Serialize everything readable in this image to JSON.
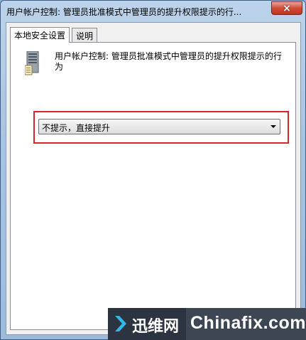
{
  "window": {
    "title": "用户帐户控制: 管理员批准模式中管理员的提升权限提示的行...",
    "close_label": "×"
  },
  "tabs": [
    {
      "label": "本地安全设置",
      "active": true
    },
    {
      "label": "说明",
      "active": false
    }
  ],
  "policy": {
    "icon": "server-icon",
    "description": "用户帐户控制: 管理员批准模式中管理员的提升权限提示的行为",
    "selected_option": "不提示，直接提升"
  },
  "highlight_color": "#d5262d",
  "watermark": {
    "chinese": "迅维网",
    "english": "Chinafix.com"
  }
}
